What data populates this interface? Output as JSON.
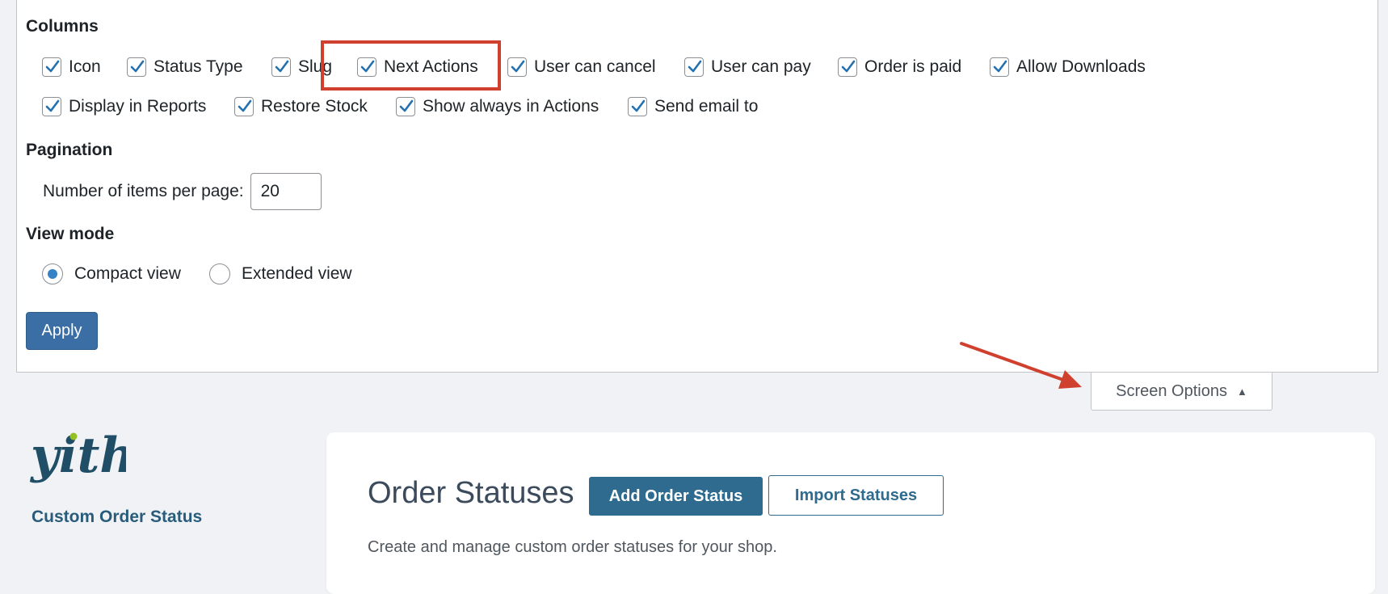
{
  "screen_options": {
    "columns_title": "Columns",
    "columns": [
      {
        "label": "Icon",
        "checked": true
      },
      {
        "label": "Status Type",
        "checked": true
      },
      {
        "label": "Slug",
        "checked": true
      },
      {
        "label": "Next Actions",
        "checked": true
      },
      {
        "label": "User can cancel",
        "checked": true
      },
      {
        "label": "User can pay",
        "checked": true
      },
      {
        "label": "Order is paid",
        "checked": true
      },
      {
        "label": "Allow Downloads",
        "checked": true
      },
      {
        "label": "Display in Reports",
        "checked": true
      },
      {
        "label": "Restore Stock",
        "checked": true
      },
      {
        "label": "Show always in Actions",
        "checked": true
      },
      {
        "label": "Send email to",
        "checked": true
      }
    ],
    "pagination_title": "Pagination",
    "items_per_page_label": "Number of items per page:",
    "items_per_page_value": "20",
    "view_mode_title": "View mode",
    "view_modes": [
      {
        "label": "Compact view",
        "checked": true
      },
      {
        "label": "Extended view",
        "checked": false
      }
    ],
    "apply_label": "Apply",
    "toggle_label": "Screen Options",
    "toggle_arrow": "▲"
  },
  "plugin": {
    "logo_text": "yith",
    "name": "Custom Order Status"
  },
  "page": {
    "title": "Order Statuses",
    "add_button": "Add Order Status",
    "import_button": "Import Statuses",
    "description": "Create and manage custom order statuses for your shop."
  },
  "colors": {
    "primary": "#3a6ea5",
    "brand": "#2f6a8f",
    "annotation": "#d0402f",
    "checkmark": "#2271b1"
  },
  "annotations": {
    "highlighted_column": "Next Actions",
    "arrow_target": "Screen Options"
  }
}
